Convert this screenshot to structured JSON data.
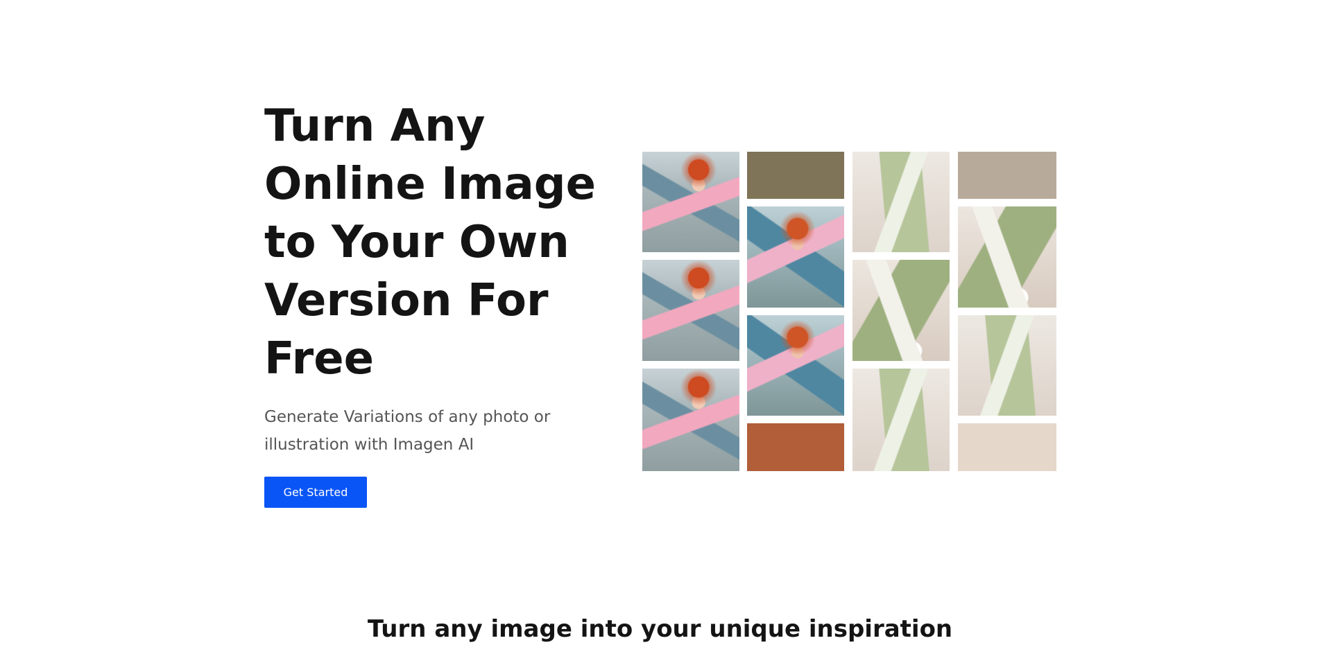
{
  "hero": {
    "title": "Turn Any Online Image to Your Own Version For Free",
    "subtitle": "Generate Variations of any photo or illustration with Imagen AI",
    "cta_label": "Get Started"
  },
  "gallery": {
    "tiles": [
      {
        "kind": "portrait",
        "name": "woman-portrait-image"
      },
      {
        "kind": "solid",
        "color": "#7f7457",
        "name": "olive-swatch"
      },
      {
        "kind": "shirt",
        "name": "green-white-top-image"
      },
      {
        "kind": "solid",
        "color": "#b8aa9a",
        "name": "beige-swatch"
      },
      {
        "kind": "portrait",
        "name": "woman-portrait-image"
      },
      {
        "kind": "portrait",
        "name": "woman-portrait-image"
      },
      {
        "kind": "shirt",
        "name": "green-top-image"
      },
      {
        "kind": "shirt",
        "name": "green-top-image"
      },
      {
        "kind": "portrait",
        "name": "woman-portrait-image"
      },
      {
        "kind": "portrait",
        "name": "woman-portrait-image"
      },
      {
        "kind": "shirt",
        "name": "green-white-top-image"
      },
      {
        "kind": "solid",
        "color": "#b15e39",
        "name": "rust-swatch"
      },
      {
        "kind": "shirt",
        "name": "green-white-top-image"
      },
      {
        "kind": "solid",
        "color": "#e5d8ca",
        "name": "cream-swatch"
      }
    ]
  },
  "section": {
    "heading": "Turn any image into your unique inspiration"
  },
  "colors": {
    "button": "#0a55f6",
    "heading": "#141414",
    "subtitle": "#555555"
  }
}
